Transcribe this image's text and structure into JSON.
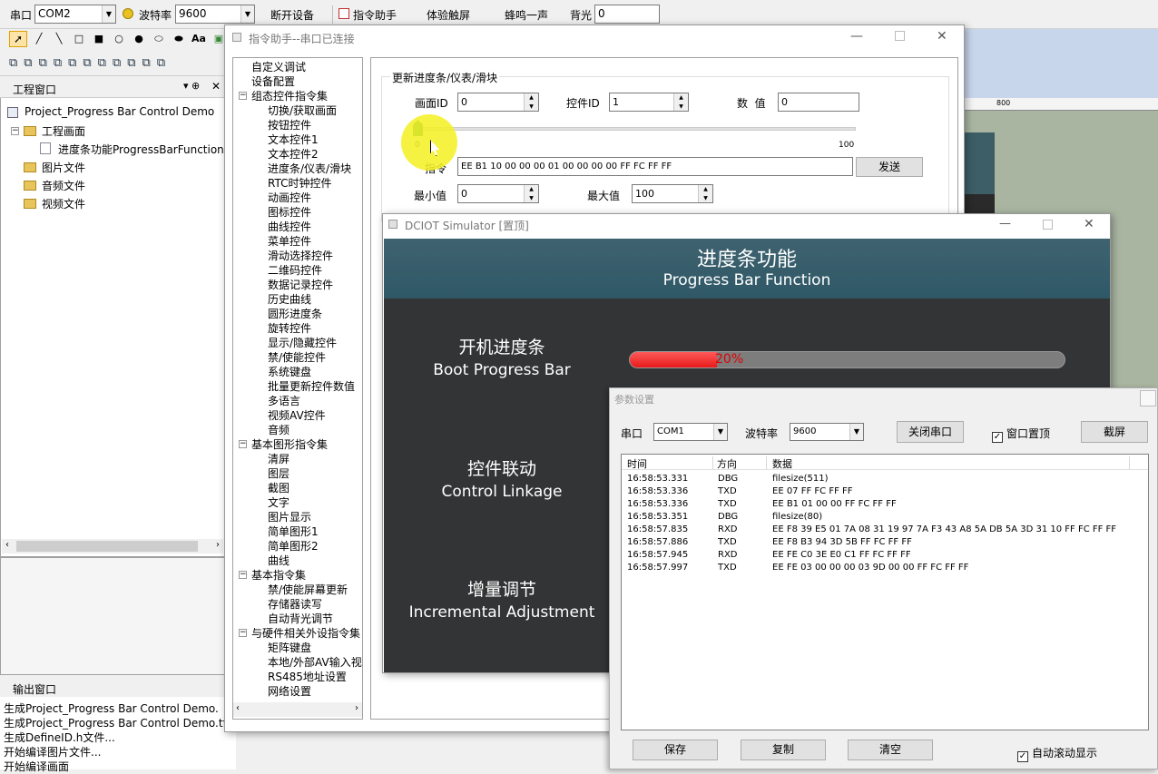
{
  "toolbar": {
    "port_label": "串口",
    "port_value": "COM2",
    "baud_label": "波特率",
    "baud_value": "9600",
    "disconnect": "断开设备",
    "cmd_helper": "指令助手",
    "touch": "体验触屏",
    "buzzer": "蜂鸣一声",
    "backlight_label": "背光",
    "backlight_value": "0"
  },
  "project_panel": {
    "title": "工程窗口",
    "root": "Project_Progress Bar Control Demo",
    "screens": "工程画面",
    "screen_item": "进度条功能ProgressBarFunction",
    "images": "图片文件",
    "audio": "音频文件",
    "video": "视频文件"
  },
  "output_panel": {
    "title": "输出窗口",
    "lines": [
      "生成Project_Progress Bar Control Demo.",
      "生成Project_Progress Bar Control Demo.tft文件...",
      "生成DefineID.h文件...",
      "开始编译图片文件...",
      "开始编译画面"
    ]
  },
  "ruler": {
    "mark": "800"
  },
  "cmd_window": {
    "title": "指令助手--串口已连接",
    "tree": [
      {
        "t": "自定义调试",
        "l": 0
      },
      {
        "t": "设备配置",
        "l": 0
      },
      {
        "t": "组态控件指令集",
        "l": 0,
        "g": "minus"
      },
      {
        "t": "切换/获取画面",
        "l": 1
      },
      {
        "t": "按钮控件",
        "l": 1
      },
      {
        "t": "文本控件1",
        "l": 1
      },
      {
        "t": "文本控件2",
        "l": 1
      },
      {
        "t": "进度条/仪表/滑块",
        "l": 1
      },
      {
        "t": "RTC时钟控件",
        "l": 1
      },
      {
        "t": "动画控件",
        "l": 1
      },
      {
        "t": "图标控件",
        "l": 1
      },
      {
        "t": "曲线控件",
        "l": 1
      },
      {
        "t": "菜单控件",
        "l": 1
      },
      {
        "t": "滑动选择控件",
        "l": 1
      },
      {
        "t": "二维码控件",
        "l": 1
      },
      {
        "t": "数据记录控件",
        "l": 1
      },
      {
        "t": "历史曲线",
        "l": 1
      },
      {
        "t": "圆形进度条",
        "l": 1
      },
      {
        "t": "旋转控件",
        "l": 1
      },
      {
        "t": "显示/隐藏控件",
        "l": 1
      },
      {
        "t": "禁/使能控件",
        "l": 1
      },
      {
        "t": "系统键盘",
        "l": 1
      },
      {
        "t": "批量更新控件数值",
        "l": 1
      },
      {
        "t": "多语言",
        "l": 1
      },
      {
        "t": "视频AV控件",
        "l": 1
      },
      {
        "t": "音频",
        "l": 1
      },
      {
        "t": "基本图形指令集",
        "l": 0,
        "g": "minus"
      },
      {
        "t": "清屏",
        "l": 1
      },
      {
        "t": "图层",
        "l": 1
      },
      {
        "t": "截图",
        "l": 1
      },
      {
        "t": "文字",
        "l": 1
      },
      {
        "t": "图片显示",
        "l": 1
      },
      {
        "t": "简单图形1",
        "l": 1
      },
      {
        "t": "简单图形2",
        "l": 1
      },
      {
        "t": "曲线",
        "l": 1
      },
      {
        "t": "基本指令集",
        "l": 0,
        "g": "minus"
      },
      {
        "t": "禁/使能屏幕更新",
        "l": 1
      },
      {
        "t": "存储器读写",
        "l": 1
      },
      {
        "t": "自动背光调节",
        "l": 1
      },
      {
        "t": "与硬件相关外设指令集",
        "l": 0,
        "g": "minus"
      },
      {
        "t": "矩阵键盘",
        "l": 1
      },
      {
        "t": "本地/外部AV输入视频",
        "l": 1
      },
      {
        "t": "RS485地址设置",
        "l": 1
      },
      {
        "t": "网络设置",
        "l": 1
      }
    ],
    "section_title": "更新进度条/仪表/滑块",
    "screen_id_label": "画面ID",
    "screen_id": "0",
    "control_id_label": "控件ID",
    "control_id": "1",
    "value_label": "数  值",
    "value": "0",
    "slider_min": "0",
    "slider_max": "100",
    "cmd_label": "指令",
    "cmd_value": "EE B1 10 00 00 00 01 00 00 00 00 FF FC FF FF",
    "send": "发送",
    "min_label": "最小值",
    "min_value": "0",
    "max_label": "最大值",
    "max_value": "100"
  },
  "simulator": {
    "title": "DCIOT Simulator [置顶]",
    "header_cn": "进度条功能",
    "header_en": "Progress Bar Function",
    "sections": [
      {
        "cn": "开机进度条",
        "en": "Boot Progress Bar"
      },
      {
        "cn": "控件联动",
        "en": "Control Linkage"
      },
      {
        "cn": "增量调节",
        "en": "Incremental Adjustment"
      }
    ],
    "progress_text": "20%",
    "progress": 0.2
  },
  "params": {
    "title": "参数设置",
    "port_label": "串口",
    "port_value": "COM1",
    "baud_label": "波特率",
    "baud_value": "9600",
    "close_port": "关闭串口",
    "topmost": "窗口置顶",
    "screenshot": "截屏",
    "columns": [
      "时间",
      "方向",
      "数据"
    ],
    "rows": [
      [
        "16:58:53.331",
        "DBG",
        "filesize(511)"
      ],
      [
        "16:58:53.336",
        "TXD",
        "EE 07 FF FC FF FF"
      ],
      [
        "16:58:53.336",
        "TXD",
        "EE B1 01 00 00 FF FC FF FF"
      ],
      [
        "16:58:53.351",
        "DBG",
        "filesize(80)"
      ],
      [
        "16:58:57.835",
        "RXD",
        "EE F8 39 E5 01 7A 08 31 19 97 7A F3 43 A8 5A DB 5A 3D 31 10 FF FC FF FF"
      ],
      [
        "16:58:57.886",
        "TXD",
        "EE F8 B3 94 3D 5B FF FC FF FF"
      ],
      [
        "16:58:57.945",
        "RXD",
        "EE FE C0 3E E0 C1 FF FC FF FF"
      ],
      [
        "16:58:57.997",
        "TXD",
        "EE FE 03 00 00 00 03 9D 00 00 FF FC FF FF"
      ]
    ],
    "save": "保存",
    "copy": "复制",
    "clear": "清空",
    "autoscroll": "自动滚动显示"
  },
  "icons": [
    "cursor-icon",
    "pen-icon",
    "line-icon",
    "rect-icon",
    "fill-rect-icon",
    "circle-icon",
    "fill-circle-icon",
    "ellipse-icon",
    "fill-ellipse-icon",
    "text-icon",
    "image-icon"
  ]
}
